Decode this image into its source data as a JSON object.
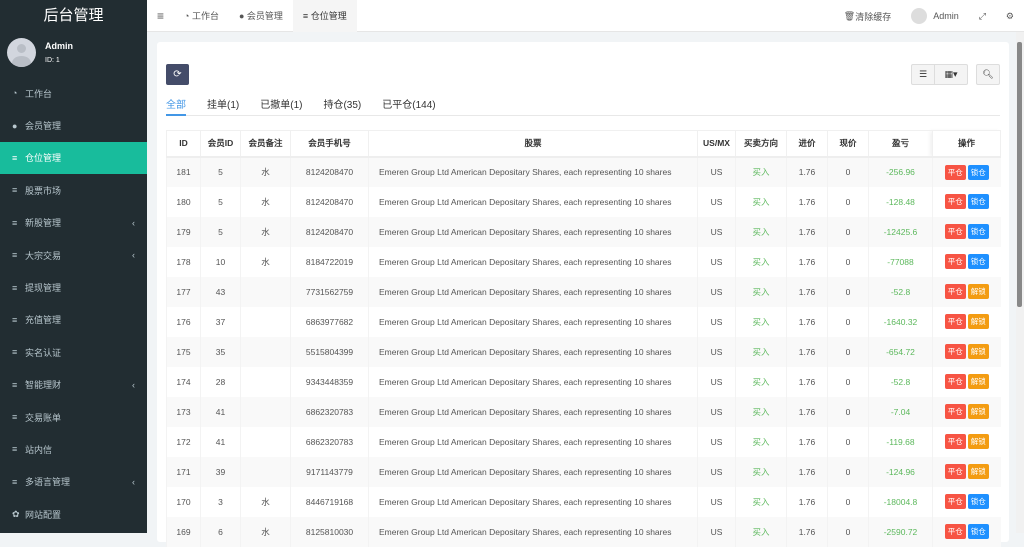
{
  "app_title": "后台管理",
  "user": {
    "name": "Admin",
    "id": "ID: 1"
  },
  "sidebar": [
    {
      "label": "工作台",
      "icon": "dashboard-icon",
      "glyph": "◔"
    },
    {
      "label": "会员管理",
      "icon": "user-circle-icon",
      "glyph": "●"
    },
    {
      "label": "仓位管理",
      "icon": "list-icon",
      "glyph": "≡",
      "active": true
    },
    {
      "label": "股票市场",
      "icon": "list-icon",
      "glyph": "≡"
    },
    {
      "label": "新股管理",
      "icon": "list-icon",
      "glyph": "≡",
      "sub": true
    },
    {
      "label": "大宗交易",
      "icon": "list-icon",
      "glyph": "≡",
      "sub": true
    },
    {
      "label": "提现管理",
      "icon": "list-icon",
      "glyph": "≡"
    },
    {
      "label": "充值管理",
      "icon": "list-icon",
      "glyph": "≡"
    },
    {
      "label": "实名认证",
      "icon": "list-icon",
      "glyph": "≡"
    },
    {
      "label": "智能理财",
      "icon": "list-icon",
      "glyph": "≡",
      "sub": true
    },
    {
      "label": "交易账单",
      "icon": "list-icon",
      "glyph": "≡"
    },
    {
      "label": "站内信",
      "icon": "list-icon",
      "glyph": "≡"
    },
    {
      "label": "多语言管理",
      "icon": "list-icon",
      "glyph": "≡",
      "sub": true
    },
    {
      "label": "网站配置",
      "icon": "gear-icon",
      "glyph": "✿"
    }
  ],
  "topbar": {
    "tabs": [
      "工作台",
      "会员管理",
      "仓位管理"
    ],
    "clear_cache": "清除缓存",
    "admin": "Admin"
  },
  "tabs": [
    "全部",
    "挂单(1)",
    "已撤单(1)",
    "持仓(35)",
    "已平仓(144)"
  ],
  "columns": [
    "ID",
    "会员ID",
    "会员备注",
    "会员手机号",
    "股票",
    "US/MX",
    "买卖方向",
    "进价",
    "现价",
    "盈亏",
    "操作"
  ],
  "buttons": {
    "close": "平仓",
    "lock": "锁仓",
    "unlock": "解锁"
  },
  "rows": [
    [
      "181",
      "5",
      "水",
      "8124208470",
      "Emeren Group Ltd American Depositary Shares, each representing 10 shares",
      "US",
      "买入",
      "1.76",
      "0",
      "-256.96",
      "lock"
    ],
    [
      "180",
      "5",
      "水",
      "8124208470",
      "Emeren Group Ltd American Depositary Shares, each representing 10 shares",
      "US",
      "买入",
      "1.76",
      "0",
      "-128.48",
      "lock"
    ],
    [
      "179",
      "5",
      "水",
      "8124208470",
      "Emeren Group Ltd American Depositary Shares, each representing 10 shares",
      "US",
      "买入",
      "1.76",
      "0",
      "-12425.6",
      "lock"
    ],
    [
      "178",
      "10",
      "水",
      "8184722019",
      "Emeren Group Ltd American Depositary Shares, each representing 10 shares",
      "US",
      "买入",
      "1.76",
      "0",
      "-77088",
      "lock"
    ],
    [
      "177",
      "43",
      "",
      "7731562759",
      "Emeren Group Ltd American Depositary Shares, each representing 10 shares",
      "US",
      "买入",
      "1.76",
      "0",
      "-52.8",
      "unlock"
    ],
    [
      "176",
      "37",
      "",
      "6863977682",
      "Emeren Group Ltd American Depositary Shares, each representing 10 shares",
      "US",
      "买入",
      "1.76",
      "0",
      "-1640.32",
      "unlock"
    ],
    [
      "175",
      "35",
      "",
      "5515804399",
      "Emeren Group Ltd American Depositary Shares, each representing 10 shares",
      "US",
      "买入",
      "1.76",
      "0",
      "-654.72",
      "unlock"
    ],
    [
      "174",
      "28",
      "",
      "9343448359",
      "Emeren Group Ltd American Depositary Shares, each representing 10 shares",
      "US",
      "买入",
      "1.76",
      "0",
      "-52.8",
      "unlock"
    ],
    [
      "173",
      "41",
      "",
      "6862320783",
      "Emeren Group Ltd American Depositary Shares, each representing 10 shares",
      "US",
      "买入",
      "1.76",
      "0",
      "-7.04",
      "unlock"
    ],
    [
      "172",
      "41",
      "",
      "6862320783",
      "Emeren Group Ltd American Depositary Shares, each representing 10 shares",
      "US",
      "买入",
      "1.76",
      "0",
      "-119.68",
      "unlock"
    ],
    [
      "171",
      "39",
      "",
      "9171143779",
      "Emeren Group Ltd American Depositary Shares, each representing 10 shares",
      "US",
      "买入",
      "1.76",
      "0",
      "-124.96",
      "unlock"
    ],
    [
      "170",
      "3",
      "水",
      "8446719168",
      "Emeren Group Ltd American Depositary Shares, each representing 10 shares",
      "US",
      "买入",
      "1.76",
      "0",
      "-18004.8",
      "lock"
    ],
    [
      "169",
      "6",
      "水",
      "8125810030",
      "Emeren Group Ltd American Depositary Shares, each representing 10 shares",
      "US",
      "买入",
      "1.76",
      "0",
      "-2590.72",
      "lock"
    ]
  ]
}
